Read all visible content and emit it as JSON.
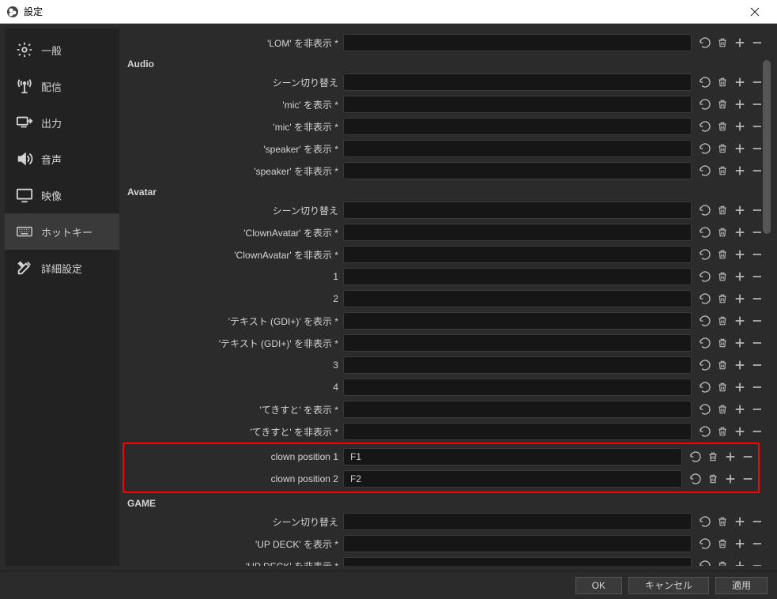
{
  "window": {
    "title": "設定"
  },
  "sidebar": {
    "items": [
      {
        "label": "一般",
        "icon": "gear-icon"
      },
      {
        "label": "配信",
        "icon": "antenna-icon"
      },
      {
        "label": "出力",
        "icon": "output-icon"
      },
      {
        "label": "音声",
        "icon": "speaker-icon"
      },
      {
        "label": "映像",
        "icon": "monitor-icon"
      },
      {
        "label": "ホットキー",
        "icon": "keyboard-icon"
      },
      {
        "label": "詳細設定",
        "icon": "tools-icon"
      }
    ],
    "active_index": 5
  },
  "sections": [
    {
      "title": "",
      "rows": [
        {
          "label": "'LOM' を非表示 *",
          "value": ""
        }
      ]
    },
    {
      "title": "Audio",
      "rows": [
        {
          "label": "シーン切り替え",
          "value": ""
        },
        {
          "label": "'mic' を表示 *",
          "value": ""
        },
        {
          "label": "'mic' を非表示 *",
          "value": ""
        },
        {
          "label": "'speaker' を表示 *",
          "value": ""
        },
        {
          "label": "'speaker' を非表示 *",
          "value": ""
        }
      ]
    },
    {
      "title": "Avatar",
      "rows": [
        {
          "label": "シーン切り替え",
          "value": ""
        },
        {
          "label": "'ClownAvatar' を表示 *",
          "value": ""
        },
        {
          "label": "'ClownAvatar' を非表示 *",
          "value": ""
        },
        {
          "label": "1",
          "value": ""
        },
        {
          "label": "2",
          "value": ""
        },
        {
          "label": "'テキスト (GDI+)' を表示 *",
          "value": ""
        },
        {
          "label": "'テキスト (GDI+)' を非表示 *",
          "value": ""
        },
        {
          "label": "3",
          "value": ""
        },
        {
          "label": "4",
          "value": ""
        },
        {
          "label": "'てきすと' を表示 *",
          "value": ""
        },
        {
          "label": "'てきすと' を非表示 *",
          "value": ""
        },
        {
          "label": "clown position 1",
          "value": "F1",
          "highlight": true
        },
        {
          "label": "clown position 2",
          "value": "F2",
          "highlight": true
        }
      ]
    },
    {
      "title": "GAME",
      "rows": [
        {
          "label": "シーン切り替え",
          "value": ""
        },
        {
          "label": "'UP DECK' を表示 *",
          "value": ""
        },
        {
          "label": "'UP DECK' を非表示 *",
          "value": ""
        }
      ]
    }
  ],
  "footer": {
    "ok": "OK",
    "cancel": "キャンセル",
    "apply": "適用"
  }
}
